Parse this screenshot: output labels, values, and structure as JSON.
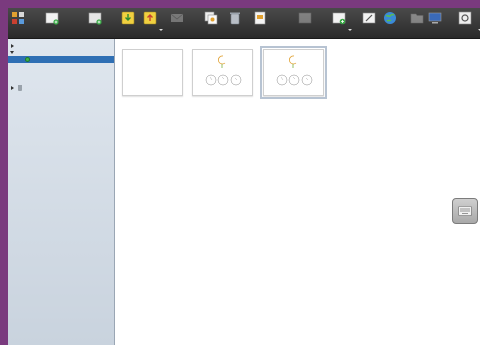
{
  "toolbar": {
    "buttons": [
      {
        "label": "",
        "icon": "tools-icon"
      },
      {
        "label": "",
        "icon": "new-document-icon"
      },
      {
        "label": "",
        "icon": "new-folder-icon"
      },
      {
        "label": "",
        "icon": "import-icon"
      },
      {
        "label": "",
        "icon": "export-icon"
      },
      {
        "label": "",
        "icon": "send-icon"
      },
      {
        "label": "",
        "icon": "duplicate-icon"
      },
      {
        "label": "",
        "icon": "trash-icon"
      },
      {
        "label": "",
        "icon": "open-page-icon"
      },
      {
        "label": "",
        "icon": "add-to-document-icon"
      },
      {
        "label": "",
        "icon": "add-icon"
      },
      {
        "label": "",
        "icon": "board-icon"
      },
      {
        "label": "",
        "icon": "web-icon"
      },
      {
        "label": "",
        "icon": "documents-icon"
      },
      {
        "label": "",
        "icon": "desktop-icon"
      },
      {
        "label": "",
        "icon": "open-sankore-icon"
      }
    ]
  },
  "sidebar": {
    "items": [
      {
        "label": ""
      },
      {
        "label": ""
      },
      {
        "label": ""
      },
      {
        "label": ""
      },
      {
        "label": ""
      },
      {
        "label": ""
      },
      {
        "label": ""
      }
    ]
  },
  "pages": [
    {
      "label": "",
      "content_text": ""
    },
    {
      "label": ""
    },
    {
      "label": ""
    }
  ],
  "colors": {
    "desktop": "#7a3a7e",
    "toolbar": "#3a3a3a",
    "sidebar": "#d5dde7",
    "selection": "#2f6fb4",
    "link": "#2a64c9"
  }
}
